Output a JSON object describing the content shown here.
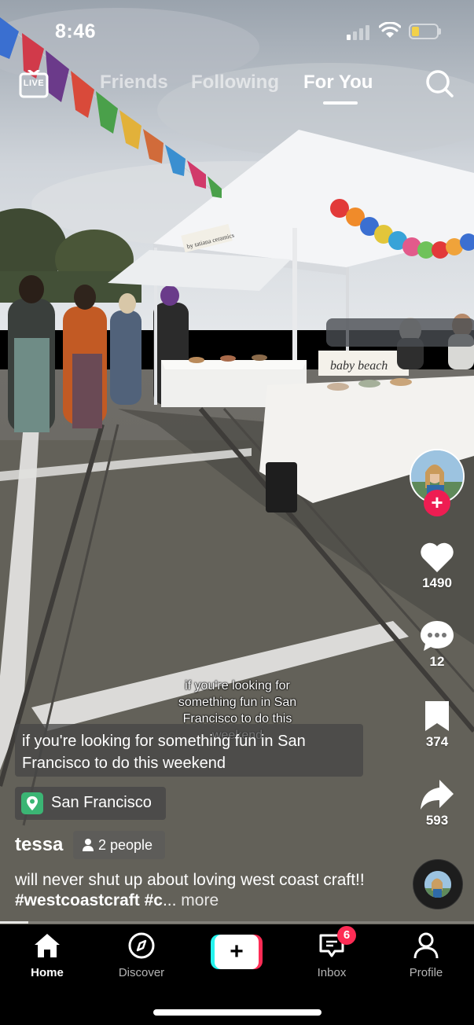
{
  "status_bar": {
    "time": "8:46",
    "battery_level": 0.3,
    "battery_color": "#f2d14a"
  },
  "top_nav": {
    "live_label": "LIVE",
    "tabs": [
      {
        "label": "Friends",
        "active": false
      },
      {
        "label": "Following",
        "active": false
      },
      {
        "label": "For You",
        "active": true
      }
    ]
  },
  "video": {
    "overlay_text": "if you're looking for something fun in San Francisco to do this weekend",
    "caption": "if you're looking for something fun in San Francisco to do this weekend",
    "location": "San Francisco",
    "username": "tessa",
    "people_tag": "2 people",
    "description_text": "will never shut up about loving west coast craft!! ",
    "description_tags": "#westcoastcraft #c",
    "description_ellipsis": "...",
    "more_label": "more",
    "progress": 0.06,
    "signs": {
      "booth": "by tatiana ceramics",
      "table": "baby beach"
    }
  },
  "rail": {
    "likes": "1490",
    "comments": "12",
    "saves": "374",
    "shares": "593"
  },
  "bottom_nav": {
    "home": "Home",
    "discover": "Discover",
    "inbox": "Inbox",
    "inbox_badge": "6",
    "profile": "Profile"
  },
  "colors": {
    "accent": "#fe2c55",
    "cyan": "#25f4ee",
    "location_green": "#3bb574"
  }
}
